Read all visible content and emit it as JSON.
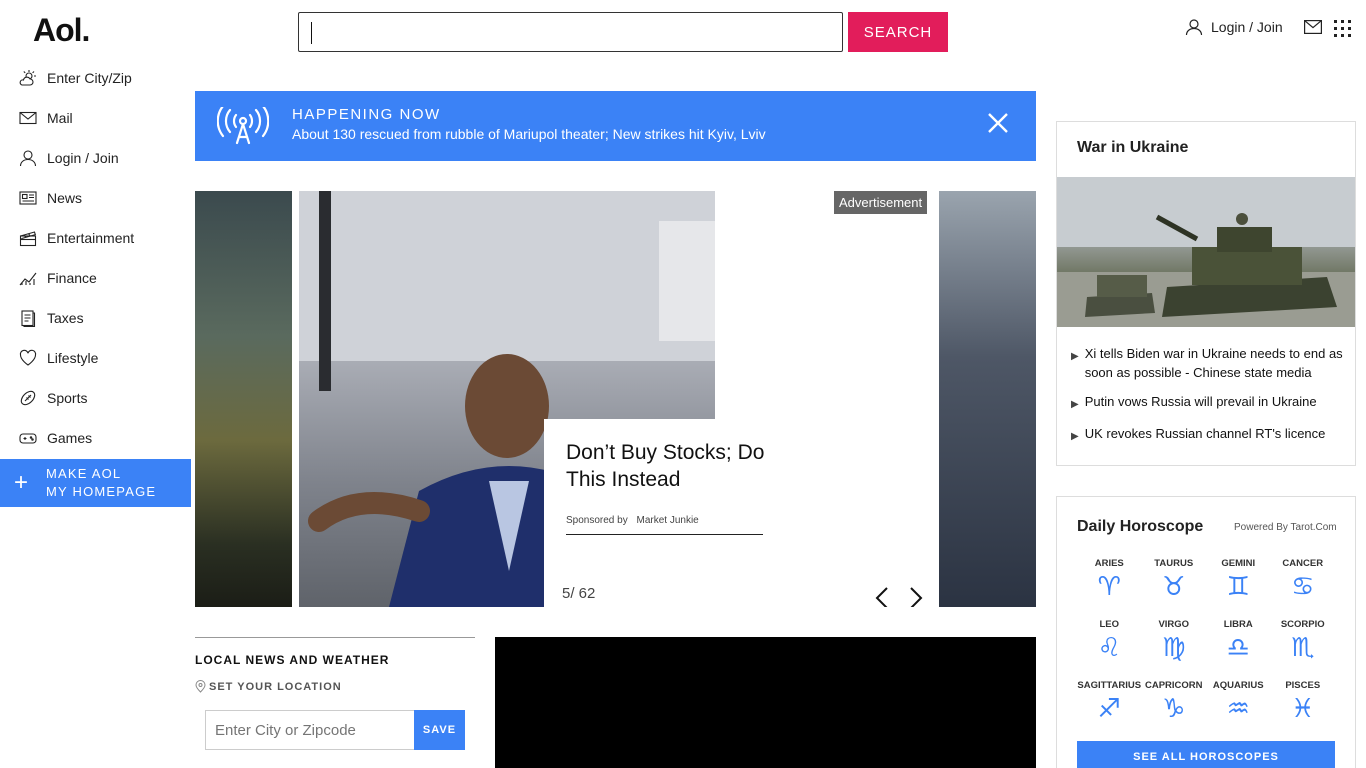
{
  "header": {
    "logo": "Aol.",
    "search_placeholder": "",
    "search_label": "SEARCH",
    "login_label": "Login / Join"
  },
  "sidebar": {
    "items": [
      {
        "label": "Enter City/Zip",
        "icon": "weather-icon"
      },
      {
        "label": "Mail",
        "icon": "mail-icon"
      },
      {
        "label": "Login / Join",
        "icon": "user-icon"
      },
      {
        "label": "News",
        "icon": "news-icon"
      },
      {
        "label": "Entertainment",
        "icon": "clapperboard-icon"
      },
      {
        "label": "Finance",
        "icon": "chart-icon"
      },
      {
        "label": "Taxes",
        "icon": "document-icon"
      },
      {
        "label": "Lifestyle",
        "icon": "heart-icon"
      },
      {
        "label": "Sports",
        "icon": "football-icon"
      },
      {
        "label": "Games",
        "icon": "gamepad-icon"
      }
    ],
    "make_home_line1": "MAKE AOL",
    "make_home_line2": "MY HOMEPAGE"
  },
  "banner": {
    "kicker": "HAPPENING NOW",
    "headline": "About 130 rescued from rubble of Mariupol theater; New strikes hit Kyiv, Lviv"
  },
  "carousel": {
    "ad_label": "Advertisement",
    "title": "Don’t Buy Stocks; Do This Instead",
    "sponsored_by": "Sponsored by",
    "sponsor": "Market Junkie",
    "counter": "5/ 62"
  },
  "local": {
    "title": "LOCAL NEWS AND WEATHER",
    "set_location": "SET YOUR LOCATION",
    "zip_placeholder": "Enter City or Zipcode",
    "save_label": "SAVE"
  },
  "ukraine": {
    "title": "War in Ukraine",
    "items": [
      "Xi tells Biden war in Ukraine needs to end as soon as possible - Chinese state media",
      "Putin vows Russia will prevail in Ukraine",
      "UK revokes Russian channel RT's licence"
    ]
  },
  "horoscope": {
    "title": "Daily Horoscope",
    "powered": "Powered By Tarot.Com",
    "signs": [
      {
        "name": "ARIES",
        "glyph": "♈"
      },
      {
        "name": "TAURUS",
        "glyph": "♉"
      },
      {
        "name": "GEMINI",
        "glyph": "♊"
      },
      {
        "name": "CANCER",
        "glyph": "♋"
      },
      {
        "name": "LEO",
        "glyph": "♌"
      },
      {
        "name": "VIRGO",
        "glyph": "♍"
      },
      {
        "name": "LIBRA",
        "glyph": "♎"
      },
      {
        "name": "SCORPIO",
        "glyph": "♏"
      },
      {
        "name": "SAGITTARIUS",
        "glyph": "♐"
      },
      {
        "name": "CAPRICORN",
        "glyph": "♑"
      },
      {
        "name": "AQUARIUS",
        "glyph": "♒"
      },
      {
        "name": "PISCES",
        "glyph": "♓"
      }
    ],
    "see_all": "SEE ALL HOROSCOPES"
  },
  "colors": {
    "brand_blue": "#3b82f6",
    "search_pink": "#e21d5b"
  }
}
